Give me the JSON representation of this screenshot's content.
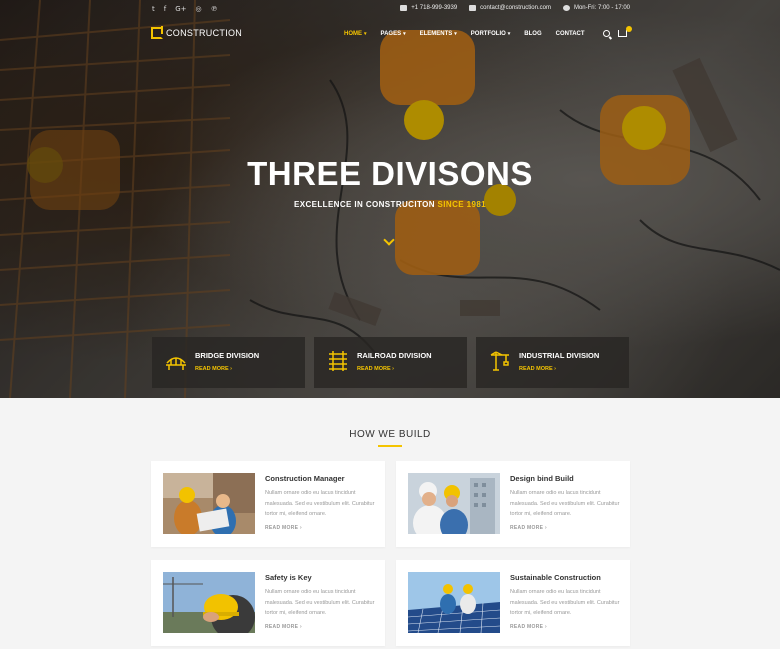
{
  "topbar": {
    "social_icons": [
      "twitter-icon",
      "facebook-icon",
      "google-plus-icon",
      "dribbble-icon",
      "pinterest-icon"
    ],
    "social_glyphs": [
      "t",
      "f",
      "G+",
      "◎",
      "℗"
    ],
    "phone": "+1 718-999-3939",
    "email": "contact@construction.com",
    "hours": "Mon-Fri: 7:00 - 17:00"
  },
  "nav": {
    "logo_text": "CONSTRUCTION",
    "items": [
      {
        "label": "HOME",
        "has_dropdown": true,
        "active": true
      },
      {
        "label": "PAGES",
        "has_dropdown": true
      },
      {
        "label": "ELEMENTS",
        "has_dropdown": true
      },
      {
        "label": "PORTFOLIO",
        "has_dropdown": true
      },
      {
        "label": "BLOG",
        "has_dropdown": false
      },
      {
        "label": "CONTACT",
        "has_dropdown": false
      }
    ]
  },
  "hero": {
    "title": "THREE DIVISONS",
    "subtitle_main": "EXCELLENCE IN CONSTRUCITON",
    "subtitle_highlight": "SINCE 1981"
  },
  "divisions": [
    {
      "title": "BRIDGE DIVISION",
      "link": "READ MORE ›",
      "icon": "bridge-icon"
    },
    {
      "title": "RAILROAD DIVISION",
      "link": "READ MORE ›",
      "icon": "railroad-icon"
    },
    {
      "title": "INDUSTRIAL DIVISION",
      "link": "READ MORE ›",
      "icon": "crane-icon"
    }
  ],
  "how_we_build": {
    "title": "HOW WE BUILD",
    "cards": [
      {
        "title": "Construction Manager",
        "text": "Nullam ornare odio eu lacus tincidunt malesuada. Sed eu vestibulum elit. Curabitur tortor mi, eleifend ornare.",
        "link": "READ MORE ›"
      },
      {
        "title": "Design bind Build",
        "text": "Nullam ornare odio eu lacus tincidunt malesuada. Sed eu vestibulum elit. Curabitur tortor mi, eleifend ornare.",
        "link": "READ MORE ›"
      },
      {
        "title": "Safety is Key",
        "text": "Nullam ornare odio eu lacus tincidunt malesuada. Sed eu vestibulum elit. Curabitur tortor mi, eleifend ornare.",
        "link": "READ MORE ›"
      },
      {
        "title": "Sustainable Construction",
        "text": "Nullam ornare odio eu lacus tincidunt malesuada. Sed eu vestibulum elit. Curabitur tortor mi, eleifend ornare.",
        "link": "READ MORE ›"
      }
    ]
  },
  "colors": {
    "accent": "#f4c400",
    "dark_panel": "#2a2623",
    "background": "#f4f4f4"
  }
}
